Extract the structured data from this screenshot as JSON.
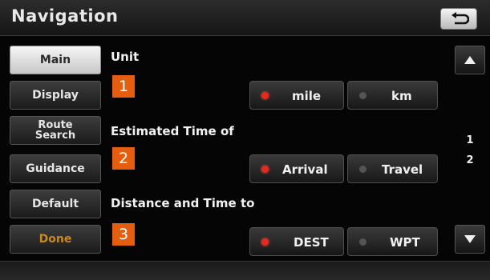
{
  "header": {
    "title": "Navigation"
  },
  "menu": [
    {
      "label": "Main",
      "active": true
    },
    {
      "label": "Display"
    },
    {
      "label": "Route Search"
    },
    {
      "label": "Guidance"
    },
    {
      "label": "Default"
    },
    {
      "label": "Done"
    }
  ],
  "sections": [
    {
      "label": "Unit",
      "badge": "1",
      "options": [
        {
          "label": "mile",
          "selected": true
        },
        {
          "label": "km",
          "selected": false
        }
      ]
    },
    {
      "label": "Estimated Time of",
      "badge": "2",
      "options": [
        {
          "label": "Arrival",
          "selected": true
        },
        {
          "label": "Travel",
          "selected": false
        }
      ]
    },
    {
      "label": "Distance and Time to",
      "badge": "3",
      "options": [
        {
          "label": "DEST",
          "selected": true
        },
        {
          "label": "WPT",
          "selected": false
        }
      ]
    }
  ],
  "pager": {
    "page_1": "1",
    "page_2": "2"
  },
  "colors": {
    "accent": "#e55d0f",
    "selected_dot": "#e52a1d",
    "done_text": "#c88a1e"
  },
  "icons": {
    "back": "back-arrow-icon",
    "scroll_up": "triangle-up-icon",
    "scroll_down": "triangle-down-icon"
  }
}
